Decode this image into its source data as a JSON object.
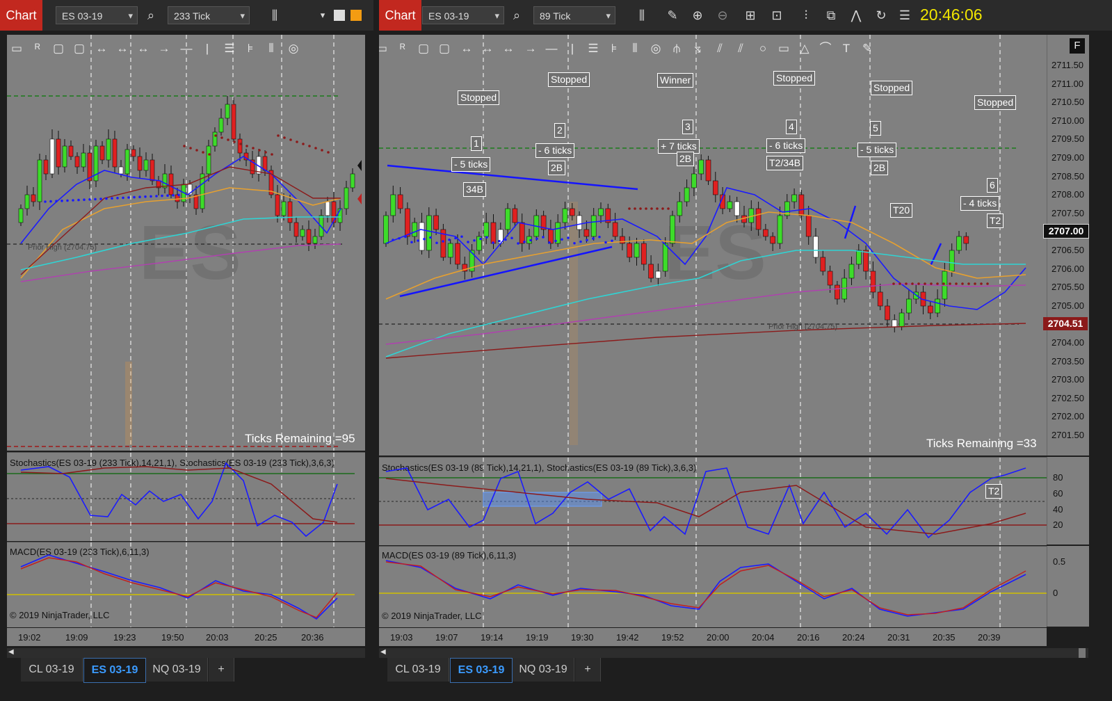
{
  "left": {
    "title_button": "Chart",
    "instrument": "ES 03-19",
    "interval": "233 Tick",
    "watermark": "ES",
    "stoch_title": "Stochastics(ES 03-19 (233 Tick),14,21,1), Stochastics(ES 03-19 (233 Tick),3,6,3)",
    "macd_title": "MACD(ES 03-19 (233 Tick),6,11,3)",
    "ticks_remaining": "Ticks Remaining =95",
    "copyright": "© 2019 NinjaTrader, LLC",
    "prior_label": "Prior High (2704.75)",
    "times": [
      "19:02",
      "19:09",
      "19:23",
      "19:50",
      "20:03",
      "20:25",
      "20:36"
    ],
    "tabs": [
      "CL 03-19",
      "ES 03-19",
      "NQ 03-19",
      "+"
    ]
  },
  "right": {
    "title_button": "Chart",
    "instrument": "ES 03-19",
    "interval": "89 Tick",
    "clock": "20:46:06",
    "watermark": "ES",
    "f_button": "F",
    "stoch_title": "Stochastics(ES 03-19 (89 Tick),14,21,1), Stochastics(ES 03-19 (89 Tick),3,6,3)",
    "macd_title": "MACD(ES 03-19 (89 Tick),6,11,3)",
    "ticks_remaining": "Ticks Remaining =33",
    "copyright": "© 2019 NinjaTrader, LLC",
    "prior_label": "Prior High (2704.75)",
    "times": [
      "19:03",
      "19:07",
      "19:14",
      "19:19",
      "19:30",
      "19:42",
      "19:52",
      "20:00",
      "20:04",
      "20:16",
      "20:24",
      "20:31",
      "20:35",
      "20:39"
    ],
    "price_axis": [
      "2711.50",
      "2711.00",
      "2710.50",
      "2710.00",
      "2709.50",
      "2709.00",
      "2708.50",
      "2708.00",
      "2707.50",
      "2707.00",
      "2706.50",
      "2706.00",
      "2705.50",
      "2705.00",
      "2704.50",
      "2704.00",
      "2703.50",
      "2703.00",
      "2702.50",
      "2702.00",
      "2701.50"
    ],
    "last_price": "2707.00",
    "prior_price": "2704.51",
    "stoch_axis": [
      "80",
      "60",
      "40",
      "20"
    ],
    "macd_axis": [
      "0.5",
      "0"
    ],
    "stoch_tag": "T2",
    "annotations": [
      {
        "id": "stopped-1",
        "text": "Stopped"
      },
      {
        "id": "stopped-2",
        "text": "Stopped"
      },
      {
        "id": "winner",
        "text": "Winner"
      },
      {
        "id": "stopped-3",
        "text": "Stopped"
      },
      {
        "id": "stopped-4",
        "text": "Stopped"
      },
      {
        "id": "stopped-5",
        "text": "Stopped"
      },
      {
        "id": "n1",
        "text": "1"
      },
      {
        "id": "ticks-1",
        "text": "- 5 ticks"
      },
      {
        "id": "b34",
        "text": "34B"
      },
      {
        "id": "n2",
        "text": "2"
      },
      {
        "id": "ticks-2",
        "text": "- 6 ticks"
      },
      {
        "id": "b2-1",
        "text": "2B"
      },
      {
        "id": "n3",
        "text": "3"
      },
      {
        "id": "ticks-3",
        "text": "+ 7 ticks"
      },
      {
        "id": "b2-2",
        "text": "2B"
      },
      {
        "id": "n4",
        "text": "4"
      },
      {
        "id": "ticks-4",
        "text": "- 6 ticks"
      },
      {
        "id": "t2-34b",
        "text": "T2/34B"
      },
      {
        "id": "n5",
        "text": "5"
      },
      {
        "id": "ticks-5",
        "text": "- 5 ticks"
      },
      {
        "id": "b2-3",
        "text": "2B"
      },
      {
        "id": "t20",
        "text": "T20"
      },
      {
        "id": "n6",
        "text": "6"
      },
      {
        "id": "ticks-6",
        "text": "- 4 ticks"
      },
      {
        "id": "t2",
        "text": "T2"
      }
    ],
    "tabs": [
      "CL 03-19",
      "ES 03-19",
      "NQ 03-19",
      "+"
    ]
  },
  "colors": {
    "chart_button": "#c2281f",
    "panel_bg": "#808080",
    "clock": "#f1e600",
    "active_tab": "#3b9bff",
    "bull_candle": "#3ddc2a",
    "bear_candle": "#e02020",
    "stoch_k": "#1a1aff",
    "stoch_d": "#8b1a1a"
  }
}
